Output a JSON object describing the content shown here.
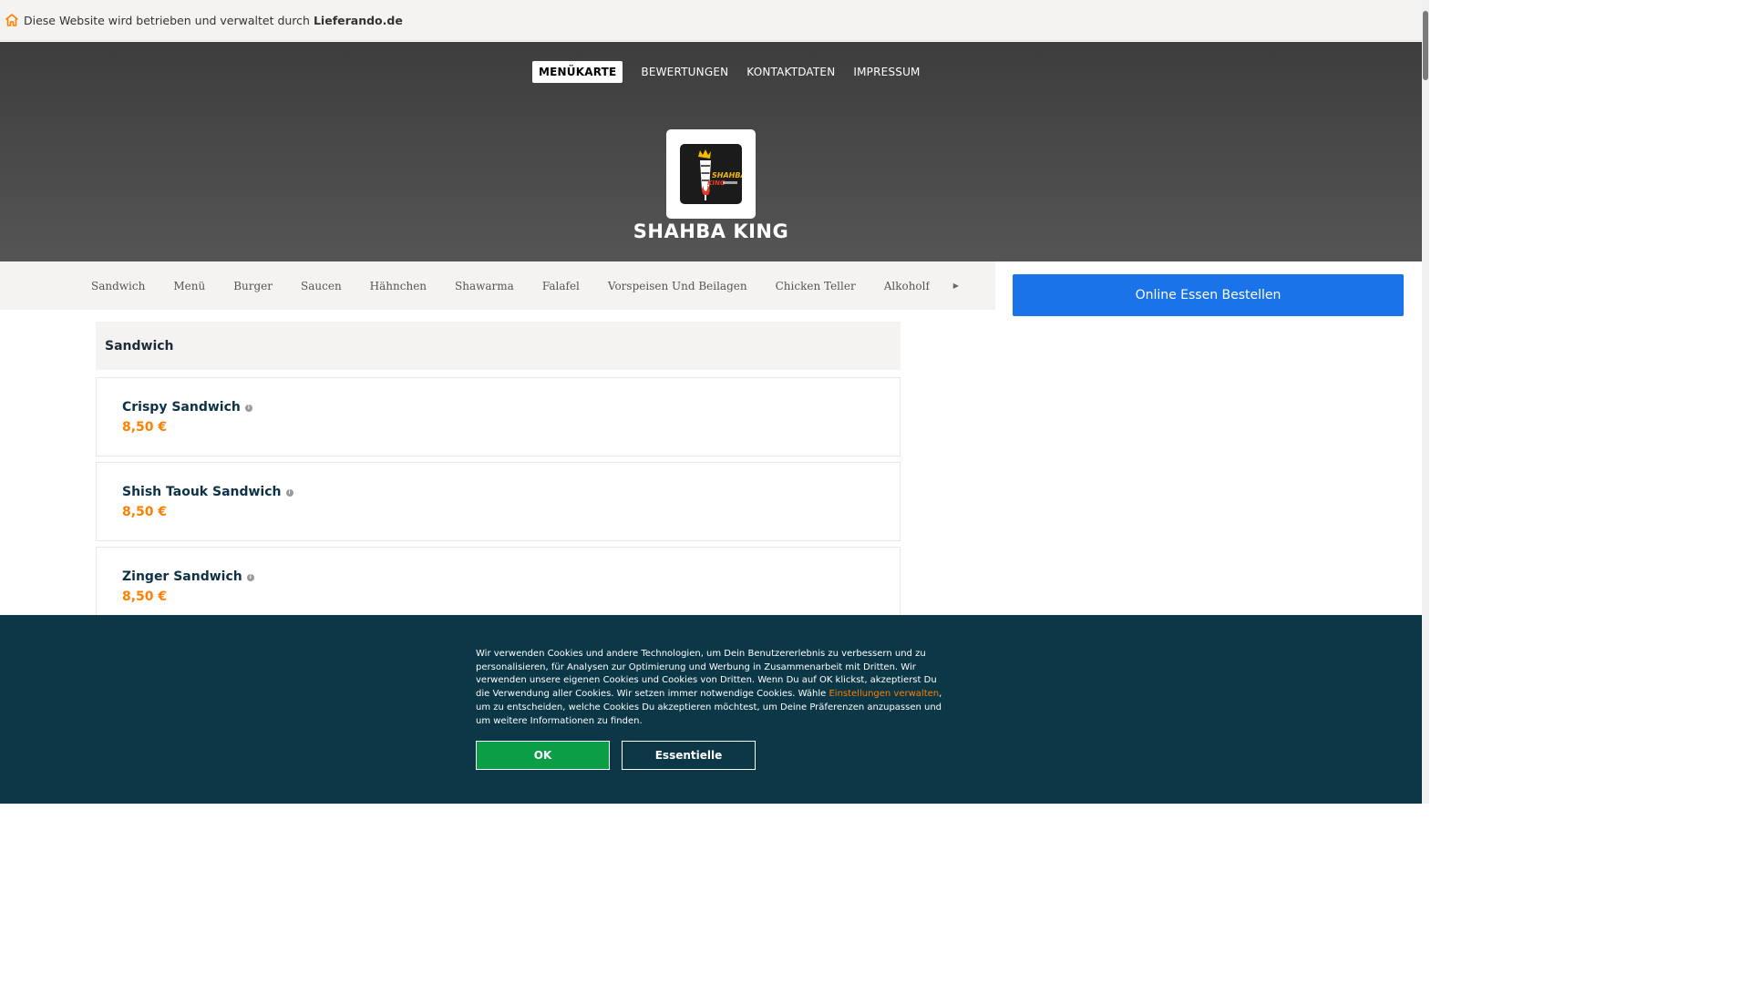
{
  "notice": {
    "text": "Diese Website wird betrieben und verwaltet durch",
    "brand": "Lieferando.de",
    "icon": "home-icon"
  },
  "topnav": {
    "items": [
      "MENÜKARTE",
      "BEWERTUNGEN",
      "KONTAKTDATEN",
      "IMPRESSUM"
    ]
  },
  "restaurant": {
    "name": "SHAHBA KING",
    "logo_text_top": "SHAHBA",
    "logo_text_bottom": "KING"
  },
  "categories": [
    "Sandwich",
    "Menü",
    "Burger",
    "Saucen",
    "Hähnchen",
    "Shawarma",
    "Falafel",
    "Vorspeisen Und Beilagen",
    "Chicken Teller",
    "Alkoholfr"
  ],
  "more_icon": "chevron-right-icon",
  "order_button": "Online Essen Bestellen",
  "section": {
    "title": "Sandwich",
    "items": [
      {
        "name": "Crispy Sandwich",
        "price": "8,50 €"
      },
      {
        "name": "Shish Taouk Sandwich",
        "price": "8,50 €"
      },
      {
        "name": "Zinger Sandwich",
        "price": "8,50 €"
      }
    ]
  },
  "cookie": {
    "text_before": "Wir verwenden Cookies und andere Technologien, um Dein Benutzererlebnis zu verbessern und zu personalisieren, für Analysen zur Optimierung und Werbung in Zusammenarbeit mit Dritten. Wir verwenden unsere eigenen Cookies und Cookies von Dritten. Wenn Du auf OK klickst, akzeptierst Du die Verwendung aller Cookies. Wir setzen immer notwendige Cookies. Wähle ",
    "link": "Einstellungen verwalten",
    "text_after": ", um zu entscheiden, welche Cookies Du akzeptieren möchtest, um Deine Präferenzen anzupassen und um weitere Informationen zu finden.",
    "ok_label": "OK",
    "essential_label": "Essentielle"
  },
  "colors": {
    "accent_orange": "#ff8000",
    "order_blue": "#1a73e8",
    "cookie_bg": "#0b3747",
    "ok_green": "#0b9e46"
  }
}
